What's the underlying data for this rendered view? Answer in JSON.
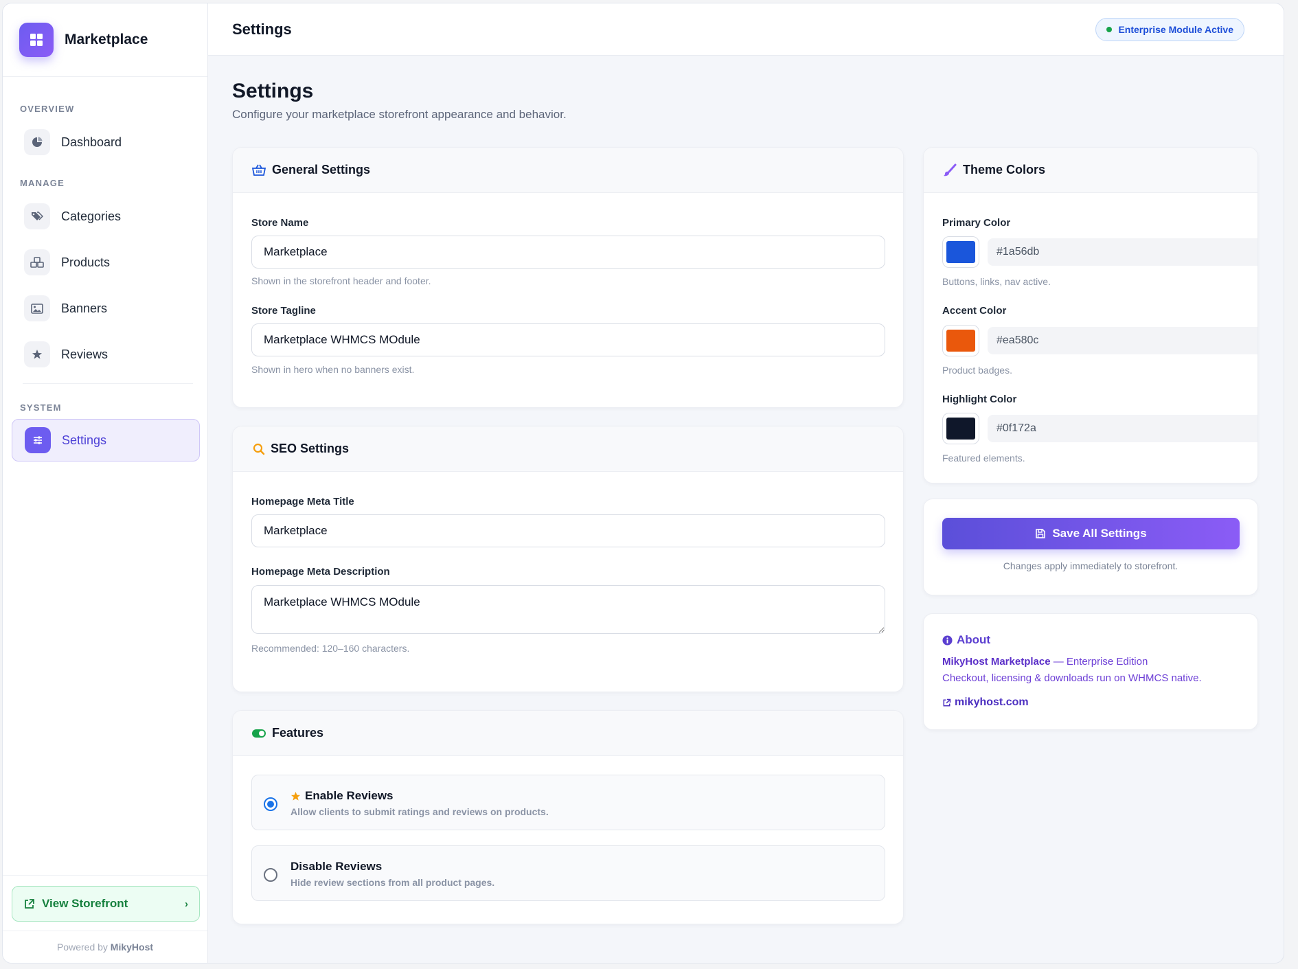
{
  "brand": {
    "name": "Marketplace",
    "logo_icon": "grid-icon"
  },
  "sidebar": {
    "sections": {
      "overview": "OVERVIEW",
      "manage": "MANAGE",
      "system": "SYSTEM"
    },
    "items": [
      {
        "label": "Dashboard",
        "icon": "pie-chart-icon"
      },
      {
        "label": "Categories",
        "icon": "tags-icon"
      },
      {
        "label": "Products",
        "icon": "cubes-icon"
      },
      {
        "label": "Banners",
        "icon": "image-icon"
      },
      {
        "label": "Reviews",
        "icon": "star-icon"
      },
      {
        "label": "Settings",
        "icon": "sliders-icon",
        "active": true
      }
    ],
    "view_storefront": "View Storefront",
    "chevron": "›",
    "powered_prefix": "Powered by",
    "powered_brand": "MikyHost"
  },
  "topbar": {
    "title": "Settings",
    "badge": "Enterprise Module Active"
  },
  "page": {
    "title": "Settings",
    "subtitle": "Configure your marketplace storefront appearance and behavior."
  },
  "general": {
    "title": "General Settings",
    "store_name_label": "Store Name",
    "store_name_value": "Marketplace",
    "store_name_hint": "Shown in the storefront header and footer.",
    "tagline_label": "Store Tagline",
    "tagline_value": "Marketplace WHMCS MOdule",
    "tagline_hint": "Shown in hero when no banners exist."
  },
  "seo": {
    "title": "SEO Settings",
    "meta_title_label": "Homepage Meta Title",
    "meta_title_value": "Marketplace",
    "meta_desc_label": "Homepage Meta Description",
    "meta_desc_value": "Marketplace WHMCS MOdule",
    "meta_desc_hint": "Recommended: 120–160 characters."
  },
  "features": {
    "title": "Features",
    "options": [
      {
        "title": "Enable Reviews",
        "desc": "Allow clients to submit ratings and reviews on products.",
        "checked": true
      },
      {
        "title": "Disable Reviews",
        "desc": "Hide review sections from all product pages.",
        "checked": false
      }
    ]
  },
  "theme": {
    "title": "Theme Colors",
    "colors": [
      {
        "label": "Primary Color",
        "value": "#1a56db",
        "hint": "Buttons, links, nav active."
      },
      {
        "label": "Accent Color",
        "value": "#ea580c",
        "hint": "Product badges."
      },
      {
        "label": "Highlight Color",
        "value": "#0f172a",
        "hint": "Featured elements."
      }
    ]
  },
  "save": {
    "label": "Save All Settings",
    "note": "Changes apply immediately to storefront."
  },
  "about": {
    "title": "About",
    "product": "MikyHost Marketplace",
    "edition": " — Enterprise Edition",
    "line2": "Checkout, licensing & downloads run on WHMCS native.",
    "link": "mikyhost.com"
  },
  "colors": {
    "accent": "#6d5cf0",
    "success": "#16a34a",
    "link": "#1d4ed8"
  }
}
